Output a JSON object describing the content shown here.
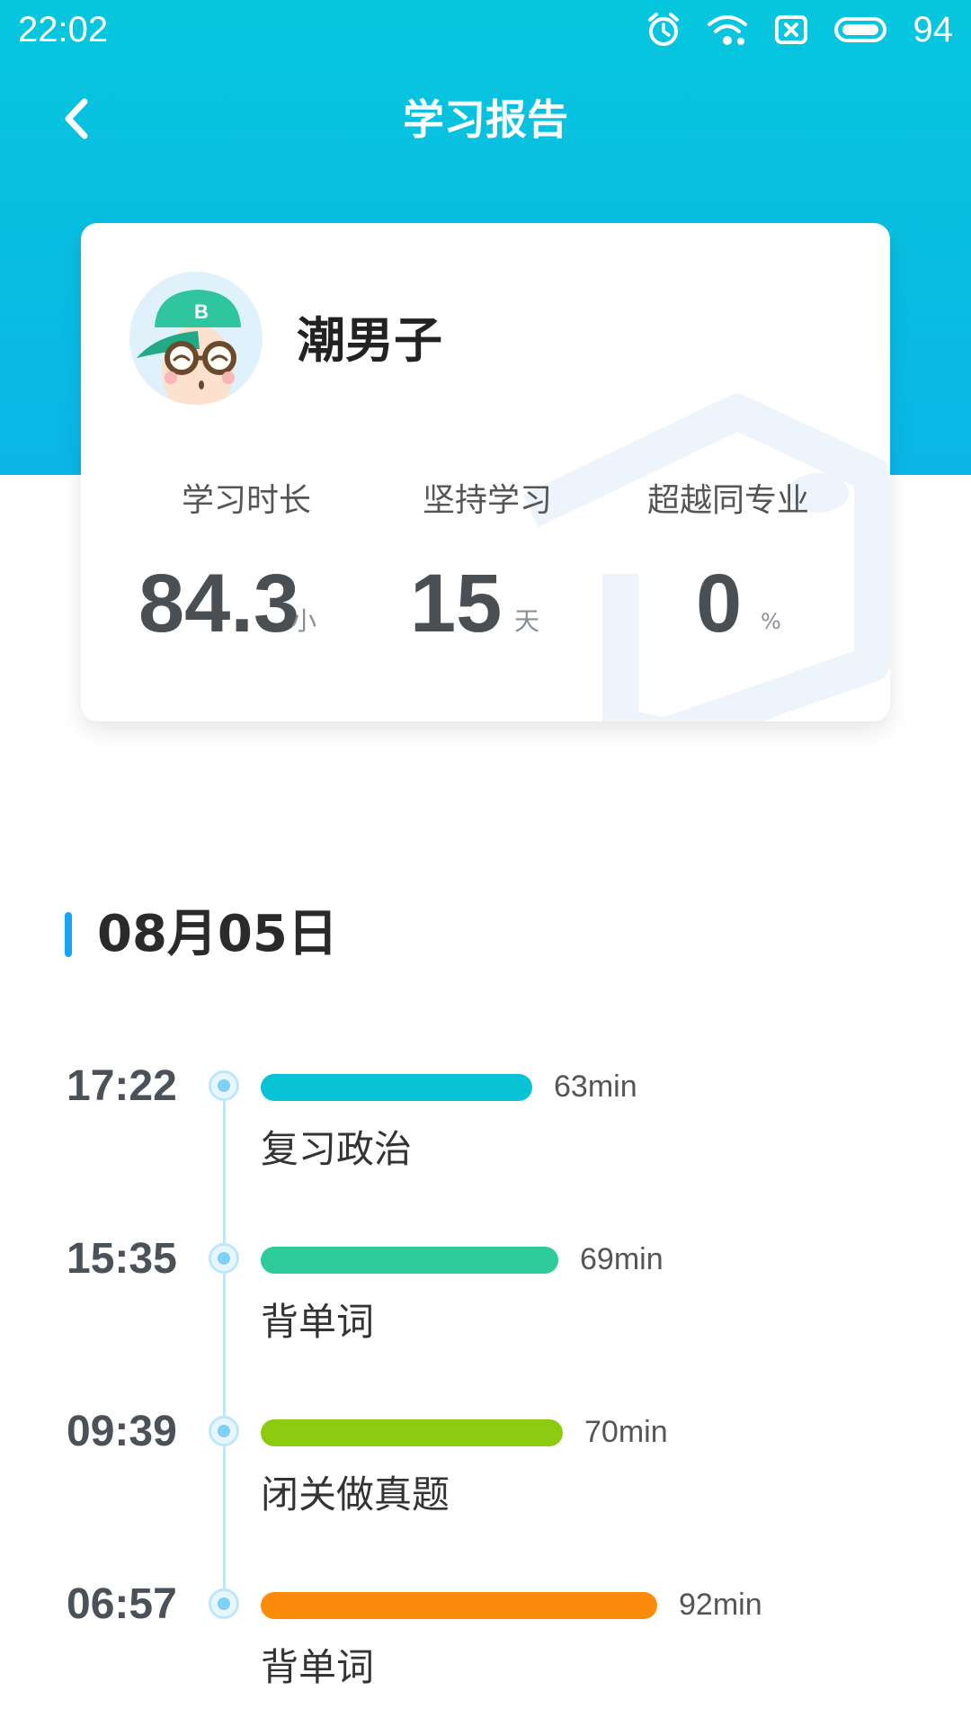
{
  "status_bar": {
    "time": "22:02",
    "battery": "94",
    "icons": [
      "alarm-icon",
      "wifi-icon",
      "sim-card-icon",
      "battery-icon"
    ]
  },
  "header": {
    "title": "学习报告",
    "back_icon": "back-arrow-icon"
  },
  "profile": {
    "name": "潮男子",
    "avatar": "cartoon-boy-with-cap-and-glasses"
  },
  "stats": [
    {
      "label": "学习时长",
      "value": "84.3",
      "unit": "小时"
    },
    {
      "label": "坚持学习",
      "value": "15",
      "unit": "天"
    },
    {
      "label": "超越同专业",
      "value": "0",
      "unit": "%"
    }
  ],
  "timeline": {
    "date": "08月05日",
    "entries": [
      {
        "time": "17:22",
        "duration": "63min",
        "activity": "复习政治",
        "color": "#08c3d6"
      },
      {
        "time": "15:35",
        "duration": "69min",
        "activity": "背单词",
        "color": "#2ecb9a"
      },
      {
        "time": "09:39",
        "duration": "70min",
        "activity": "闭关做真题",
        "color": "#8ccb0f"
      },
      {
        "time": "06:57",
        "duration": "92min",
        "activity": "背单词",
        "color": "#fb8c0b"
      }
    ]
  },
  "colors": {
    "header_gradient_top": "#06c6dd",
    "header_gradient_bottom": "#0bb6e6",
    "date_accent": "#1aa3f3"
  }
}
